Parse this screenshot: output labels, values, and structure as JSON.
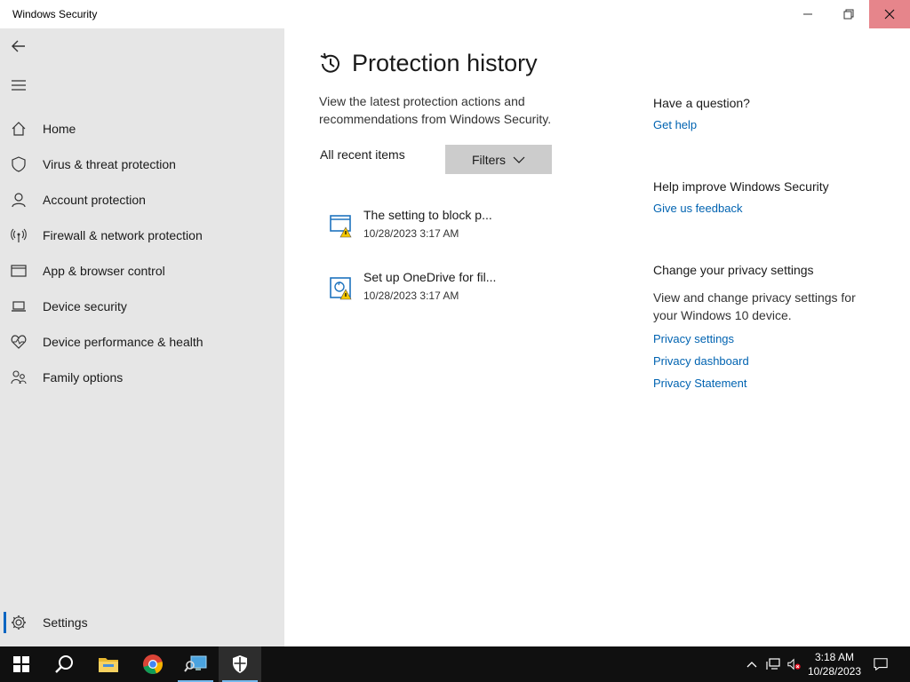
{
  "window": {
    "title": "Windows Security"
  },
  "sidebar": {
    "items": [
      {
        "label": "Home",
        "icon": "home-icon"
      },
      {
        "label": "Virus & threat protection",
        "icon": "shield-icon"
      },
      {
        "label": "Account protection",
        "icon": "person-icon"
      },
      {
        "label": "Firewall & network protection",
        "icon": "antenna-icon"
      },
      {
        "label": "App & browser control",
        "icon": "browser-window-icon"
      },
      {
        "label": "Device security",
        "icon": "laptop-icon"
      },
      {
        "label": "Device performance & health",
        "icon": "heart-pulse-icon"
      },
      {
        "label": "Family options",
        "icon": "family-icon"
      }
    ],
    "settings_label": "Settings"
  },
  "main": {
    "title": "Protection history",
    "description": "View the latest protection actions and recommendations from Windows Security.",
    "recent_label": "All recent items",
    "filters_label": "Filters",
    "history": [
      {
        "title": "The setting to block p...",
        "time": "10/28/2023 3:17 AM",
        "icon": "app-warning-icon"
      },
      {
        "title": "Set up OneDrive for fil...",
        "time": "10/28/2023 3:17 AM",
        "icon": "folder-sync-warning-icon"
      }
    ]
  },
  "help": {
    "question_heading": "Have a question?",
    "get_help": "Get help",
    "improve_heading": "Help improve Windows Security",
    "feedback": "Give us feedback",
    "privacy_heading": "Change your privacy settings",
    "privacy_text": "View and change privacy settings for your Windows 10 device.",
    "privacy_settings": "Privacy settings",
    "privacy_dashboard": "Privacy dashboard",
    "privacy_statement": "Privacy Statement"
  },
  "taskbar": {
    "time": "3:18 AM",
    "date": "10/28/2023"
  },
  "colors": {
    "accent": "#0063b1",
    "sidebar_bg": "#e6e6e6",
    "close_hover": "#e6858b",
    "taskbar_bg": "#101010"
  }
}
